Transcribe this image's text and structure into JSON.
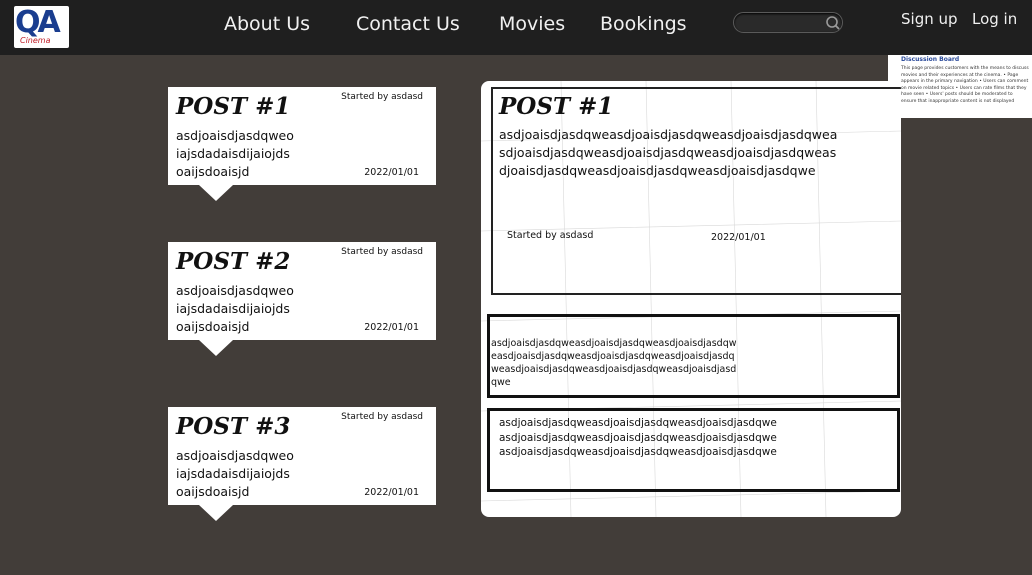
{
  "header": {
    "logo": {
      "mark": "QA",
      "subtext": "Cinema"
    },
    "nav": [
      "About Us",
      "Contact Us",
      "Movies",
      "Bookings"
    ],
    "search": {
      "value": "",
      "placeholder": ""
    },
    "auth": {
      "signup": "Sign up",
      "login": "Log in"
    }
  },
  "thumbnail": {
    "title": "Discussion Board",
    "text": "This page provides customers with the means to discuss movies and their experiences at the cinema. • Page appears in the primary navigation • Users can comment on movie related topics • Users can rate films that they have seen • Users' posts should be moderated to ensure that inappropriate content is not displayed"
  },
  "posts": [
    {
      "title": "POST #1",
      "started_by": "Started by asdasd",
      "body": "asdjoaisdjasdqweoiajsdadaisdijaiojdsoaijsdoaisjd",
      "date": "2022/01/01"
    },
    {
      "title": "POST #2",
      "started_by": "Started by asdasd",
      "body": "asdjoaisdjasdqweoiajsdadaisdijaiojdsoaijsdoaisjd",
      "date": "2022/01/01"
    },
    {
      "title": "POST #3",
      "started_by": "Started by asdasd",
      "body": "asdjoaisdjasdqweoiajsdadaisdijaiojdsoaijsdoaisjd",
      "date": "2022/01/01"
    }
  ],
  "detail": {
    "title": "POST #1",
    "body": "asdjoaisdjasdqweasdjoaisdjasdqweasdjoaisdjasdqweasdjoaisdjasdqweasdjoaisdjasdqweasdjoaisdjasdqweasdjoaisdjasdqweasdjoaisdjasdqweasdjoaisdjasdqwe",
    "started_by": "Started by asdasd",
    "date": "2022/01/01",
    "replies": [
      {
        "body": "asdjoaisdjasdqweasdjoaisdjasdqweasdjoaisdjasdqweasdjoaisdjasdqweasdjoaisdjasdqweasdjoaisdjasdqweasdjoaisdjasdqweasdjoaisdjasdqweasdjoaisdjasdqwe"
      },
      {
        "body": "asdjoaisdjasdqweasdjoaisdjasdqweasdjoaisdjasdqweasdjoaisdjasdqweasdjoaisdjasdqweasdjoaisdjasdqweasdjoaisdjasdqweasdjoaisdjasdqweasdjoaisdjasdqwe"
      }
    ]
  },
  "colors": {
    "background": "#423d39",
    "header": "#1f1f1f",
    "card": "#ffffff",
    "logo_blue": "#1a3d8f",
    "logo_red": "#c0202a"
  }
}
